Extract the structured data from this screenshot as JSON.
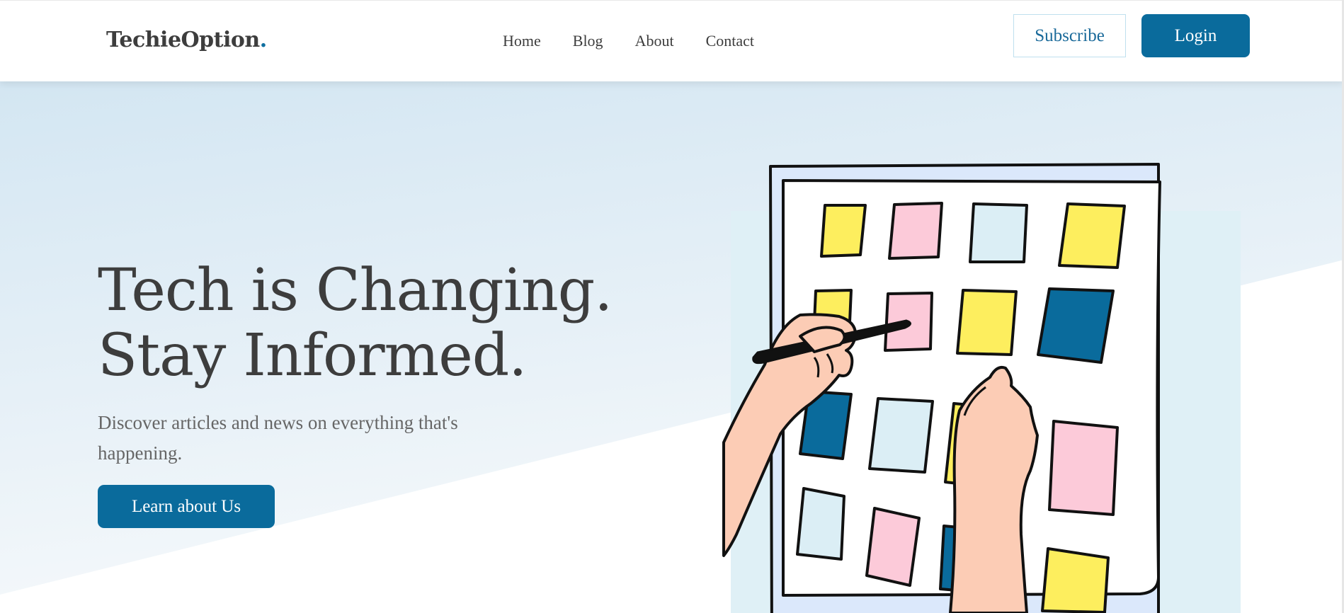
{
  "header": {
    "logo_text": "TechieOption",
    "logo_dot": ".",
    "nav": [
      {
        "label": "Home"
      },
      {
        "label": "Blog"
      },
      {
        "label": "About"
      },
      {
        "label": "Contact"
      }
    ],
    "subscribe_label": "Subscribe",
    "login_label": "Login"
  },
  "hero": {
    "headline_line1": "Tech is Changing.",
    "headline_line2": "Stay Informed.",
    "subtext": "Discover articles and news on everything that's happening.",
    "cta_label": "Learn about Us"
  },
  "colors": {
    "brand_blue": "#0a6b9c",
    "hero_gradient_top": "#d6e8f3",
    "note_yellow": "#fdee5e",
    "note_pink": "#fccad9",
    "note_light_blue": "#dbeef5",
    "note_dark_blue": "#0a6b9c",
    "skin": "#fcccb5"
  },
  "illustration": {
    "icon": "sticky-notes-board-illustration"
  }
}
